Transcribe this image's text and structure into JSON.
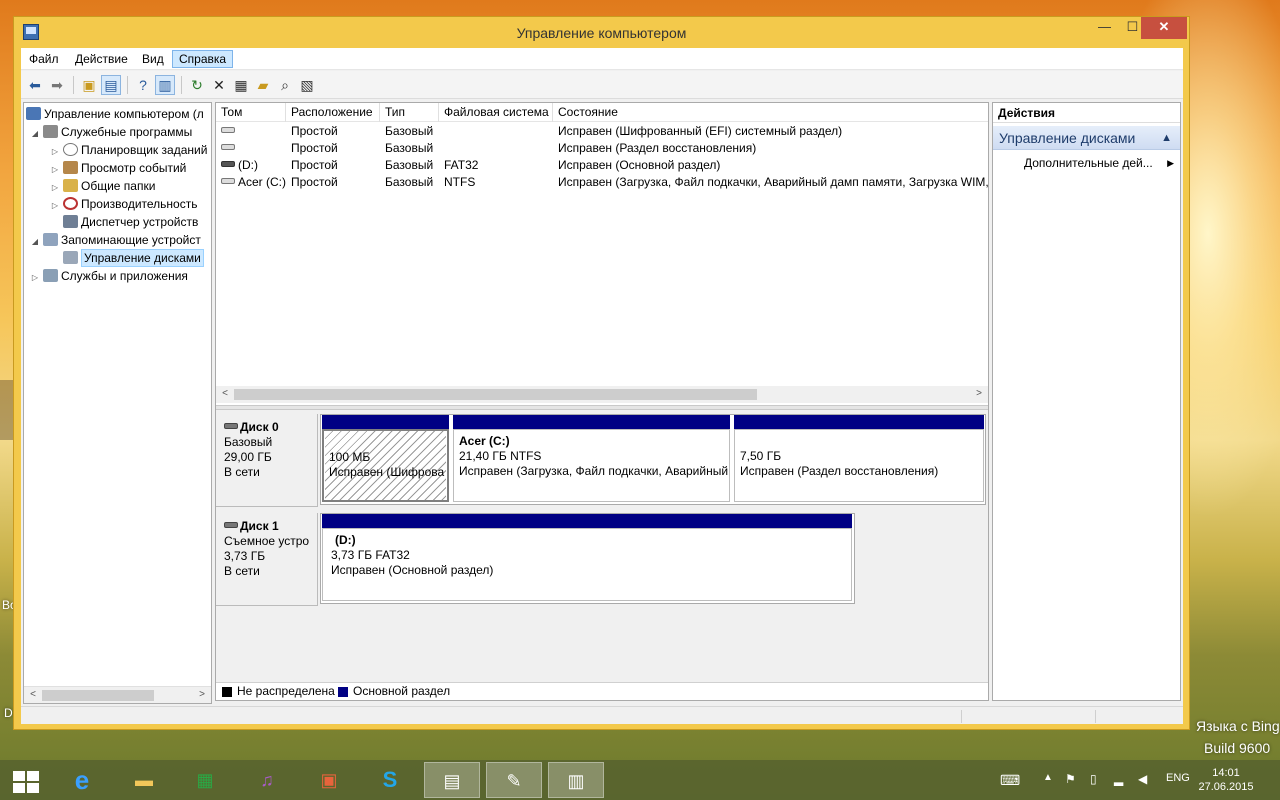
{
  "desktop": {
    "edge_text_1": "Во",
    "edge_text_2": "D",
    "watermark_1": "Языка с Bing",
    "watermark_2": "Build 9600"
  },
  "window": {
    "title": "Управление компьютером",
    "controls": {
      "minimize": "—",
      "maximize": "☐",
      "close": "✕"
    }
  },
  "menu": [
    "Файл",
    "Действие",
    "Вид",
    "Справка"
  ],
  "toolbar": {
    "icons": [
      "back-icon",
      "forward-icon",
      "up-folder-icon",
      "show-hide-tree-icon",
      "help-icon",
      "show-hide-action-pane-icon",
      "refresh-icon",
      "delete-icon",
      "properties-icon",
      "open-icon",
      "search-icon",
      "export-icon"
    ]
  },
  "tree": {
    "items": [
      {
        "label": "Управление компьютером (л",
        "icon": "computer-management-icon"
      },
      {
        "label": "Служебные программы",
        "icon": "tools-icon"
      },
      {
        "label": "Планировщик заданий",
        "icon": "clock-icon"
      },
      {
        "label": "Просмотр событий",
        "icon": "event-viewer-icon"
      },
      {
        "label": "Общие папки",
        "icon": "shared-folders-icon"
      },
      {
        "label": "Производительность",
        "icon": "performance-icon"
      },
      {
        "label": "Диспетчер устройств",
        "icon": "device-manager-icon"
      },
      {
        "label": "Запоминающие устройст",
        "icon": "storage-icon"
      },
      {
        "label": "Управление дисками",
        "icon": "disk-management-icon"
      },
      {
        "label": "Службы и приложения",
        "icon": "services-icon"
      }
    ]
  },
  "volume_list": {
    "columns": [
      "Том",
      "Расположение",
      "Тип",
      "Файловая система",
      "Состояние"
    ],
    "rows": [
      {
        "volume": "",
        "layout": "Простой",
        "type": "Базовый",
        "fs": "",
        "status": "Исправен (Шифрованный (EFI) системный раздел)"
      },
      {
        "volume": "",
        "layout": "Простой",
        "type": "Базовый",
        "fs": "",
        "status": "Исправен (Раздел восстановления)"
      },
      {
        "volume": "(D:)",
        "layout": "Простой",
        "type": "Базовый",
        "fs": "FAT32",
        "status": "Исправен (Основной раздел)"
      },
      {
        "volume": "Acer (C:)",
        "layout": "Простой",
        "type": "Базовый",
        "fs": "NTFS",
        "status": "Исправен (Загрузка, Файл подкачки, Аварийный дамп памяти, Загрузка WIM,"
      }
    ]
  },
  "disks": [
    {
      "name": "Диск 0",
      "type": "Базовый",
      "size": "29,00 ГБ",
      "state": "В сети",
      "partitions": [
        {
          "title": "",
          "size": "100 МБ",
          "status": "Исправен (Шифрова"
        },
        {
          "title": "Acer  (C:)",
          "size": "21,40 ГБ NTFS",
          "status": "Исправен (Загрузка, Файл подкачки, Аварийный"
        },
        {
          "title": "",
          "size": "7,50 ГБ",
          "status": "Исправен (Раздел восстановления)"
        }
      ]
    },
    {
      "name": "Диск 1",
      "type": "Съемное устро",
      "size": "3,73 ГБ",
      "state": "В сети",
      "partitions": [
        {
          "title": "(D:)",
          "size": "3,73 ГБ FAT32",
          "status": "Исправен (Основной раздел)"
        }
      ]
    }
  ],
  "legend": {
    "unallocated": "Не распределена",
    "primary": "Основной раздел",
    "colors": {
      "unallocated": "#000000",
      "primary": "#000084"
    }
  },
  "actions": {
    "header": "Действия",
    "section": "Управление дисками",
    "item": "Дополнительные дей..."
  },
  "taskbar": {
    "apps": [
      "start-icon",
      "internet-explorer-icon",
      "file-explorer-icon",
      "store-icon",
      "media-icon",
      "photos-icon",
      "skype-icon",
      "control-panel-icon",
      "paint-icon",
      "computer-management-icon"
    ],
    "lang": "ENG",
    "time": "14:01",
    "date": "27.06.2015"
  }
}
